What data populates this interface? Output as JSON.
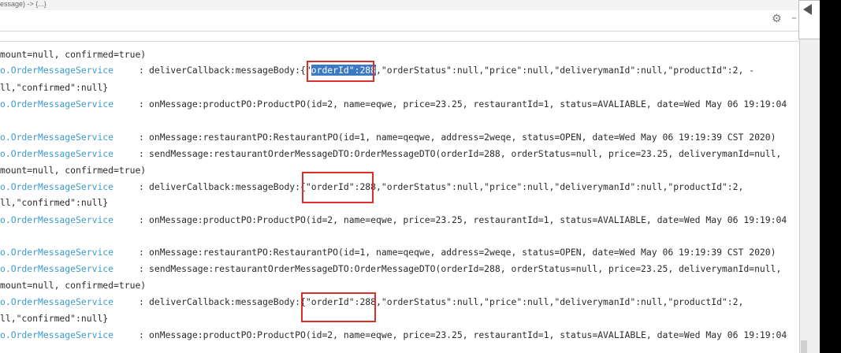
{
  "topbar": {
    "text": "essage) -> {...}"
  },
  "toolbar": {
    "gear_icon": "gear-icon",
    "minimize_glyph": "–"
  },
  "console": {
    "lines": [
      {
        "src": "",
        "msg": "mount=null, confirmed=true)"
      },
      {
        "src": "o.OrderMessageService",
        "msg_before": "deliverCallback:messageBody:{\"",
        "msg_highlight": "orderId\":288",
        "msg_after": ",\"orderStatus\":null,\"price\":null,\"deliverymanId\":null,\"productId\":2, -"
      },
      {
        "src": "",
        "msg": "ll,\"confirmed\":null}"
      },
      {
        "src": "o.OrderMessageService",
        "msg": "onMessage:productPO:ProductPO(id=2, name=eqwe, price=23.25, restaurantId=1, status=AVALIABLE, date=Wed May 06 19:19:04"
      },
      {
        "src": "",
        "msg": ""
      },
      {
        "src": "o.OrderMessageService",
        "msg": "onMessage:restaurantPO:RestaurantPO(id=1, name=qeqwe, address=2weqe, status=OPEN, date=Wed May 06 19:19:39 CST 2020)"
      },
      {
        "src": "o.OrderMessageService",
        "msg": "sendMessage:restaurantOrderMessageDTO:OrderMessageDTO(orderId=288, orderStatus=null, price=23.25, deliverymanId=null,"
      },
      {
        "src": "",
        "msg": "mount=null, confirmed=true)"
      },
      {
        "src": "o.OrderMessageService",
        "msg": "deliverCallback:messageBody:{\"orderId\":288,\"orderStatus\":null,\"price\":null,\"deliverymanId\":null,\"productId\":2,"
      },
      {
        "src": "",
        "msg": "ll,\"confirmed\":null}"
      },
      {
        "src": "o.OrderMessageService",
        "msg": "onMessage:productPO:ProductPO(id=2, name=eqwe, price=23.25, restaurantId=1, status=AVALIABLE, date=Wed May 06 19:19:04"
      },
      {
        "src": "",
        "msg": ""
      },
      {
        "src": "o.OrderMessageService",
        "msg": "onMessage:restaurantPO:RestaurantPO(id=1, name=qeqwe, address=2weqe, status=OPEN, date=Wed May 06 19:19:39 CST 2020)"
      },
      {
        "src": "o.OrderMessageService",
        "msg": "sendMessage:restaurantOrderMessageDTO:OrderMessageDTO(orderId=288, orderStatus=null, price=23.25, deliverymanId=null,"
      },
      {
        "src": "",
        "msg": "mount=null, confirmed=true)"
      },
      {
        "src": "o.OrderMessageService",
        "msg": "deliverCallback:messageBody:{\"orderId\":288,\"orderStatus\":null,\"price\":null,\"deliverymanId\":null,\"productId\":2,"
      },
      {
        "src": "",
        "msg": "ll,\"confirmed\":null}"
      },
      {
        "src": "o.OrderMessageService",
        "msg": "onMessage:productPO:ProductPO(id=2, name=eqwe, price=23.25, restaurantId=1, status=AVALIABLE, date=Wed May 06 19:19:04"
      }
    ],
    "separator": ":"
  },
  "colors": {
    "source_class": "#3d9bcd",
    "annotation_box": "#d9302b",
    "selection": "#3c79c5"
  }
}
